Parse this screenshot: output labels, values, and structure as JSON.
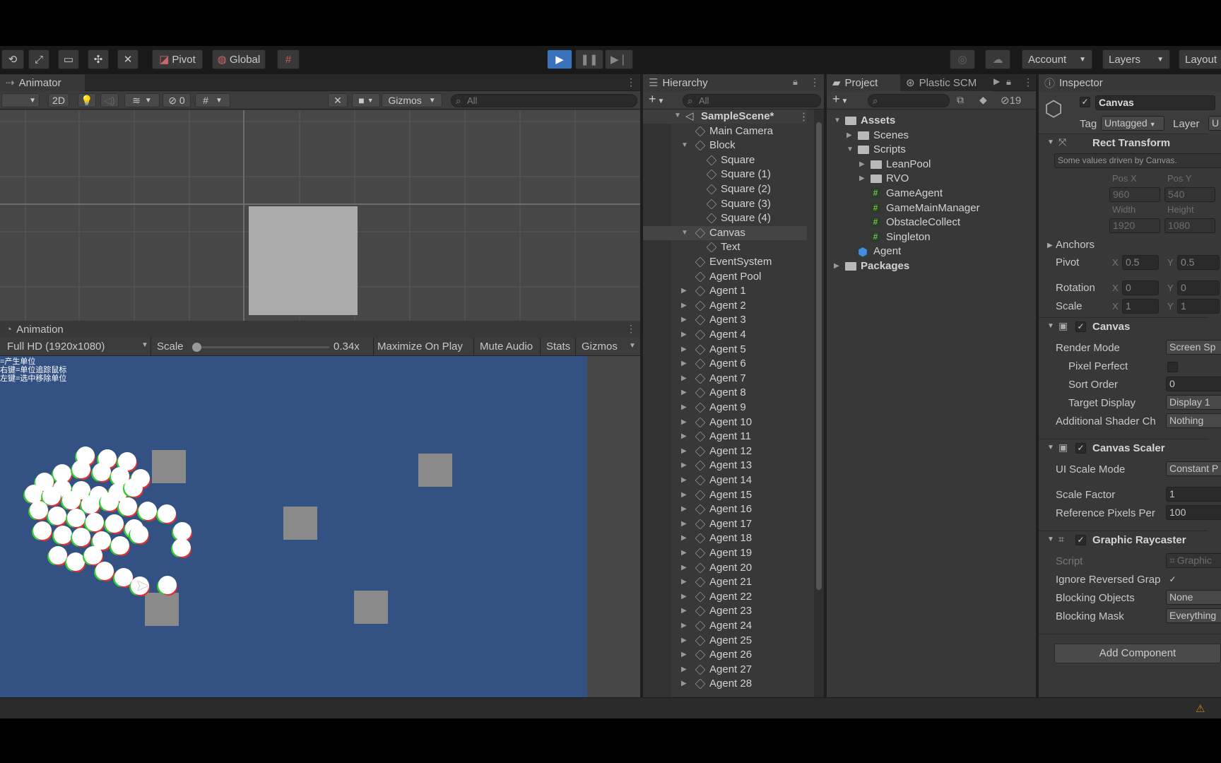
{
  "toolbar": {
    "pivot": "Pivot",
    "global": "Global",
    "account": "Account",
    "layers": "Layers",
    "layout": "Layout"
  },
  "animator": {
    "tab": "Animator",
    "mode_2d": "2D",
    "hidden_count": "0",
    "gizmos": "Gizmos",
    "search_placeholder": "All"
  },
  "game": {
    "tab": "Animation",
    "resolution": "Full HD (1920x1080)",
    "scale_label": "Scale",
    "scale_value": "0.34x",
    "maximize": "Maximize On Play",
    "mute": "Mute Audio",
    "stats": "Stats",
    "gizmos": "Gizmos",
    "overlay_lines": [
      "=产生单位",
      "右键=单位追踪鼠标",
      "左键=选中移除单位"
    ]
  },
  "hierarchy": {
    "tab": "Hierarchy",
    "search_placeholder": "All",
    "scene": "SampleScene*",
    "items": [
      {
        "label": "Main Camera"
      },
      {
        "label": "Block"
      },
      {
        "label": "Square"
      },
      {
        "label": "Square (1)"
      },
      {
        "label": "Square (2)"
      },
      {
        "label": "Square (3)"
      },
      {
        "label": "Square (4)"
      },
      {
        "label": "Canvas"
      },
      {
        "label": "Text"
      },
      {
        "label": "EventSystem"
      },
      {
        "label": "Agent Pool"
      },
      {
        "label": "Agent 1"
      },
      {
        "label": "Agent 2"
      },
      {
        "label": "Agent 3"
      },
      {
        "label": "Agent 4"
      },
      {
        "label": "Agent 5"
      },
      {
        "label": "Agent 6"
      },
      {
        "label": "Agent 7"
      },
      {
        "label": "Agent 8"
      },
      {
        "label": "Agent 9"
      },
      {
        "label": "Agent 10"
      },
      {
        "label": "Agent 11"
      },
      {
        "label": "Agent 12"
      },
      {
        "label": "Agent 13"
      },
      {
        "label": "Agent 14"
      },
      {
        "label": "Agent 15"
      },
      {
        "label": "Agent 16"
      },
      {
        "label": "Agent 17"
      },
      {
        "label": "Agent 18"
      },
      {
        "label": "Agent 19"
      },
      {
        "label": "Agent 20"
      },
      {
        "label": "Agent 21"
      },
      {
        "label": "Agent 22"
      },
      {
        "label": "Agent 23"
      },
      {
        "label": "Agent 24"
      },
      {
        "label": "Agent 25"
      },
      {
        "label": "Agent 26"
      },
      {
        "label": "Agent 27"
      },
      {
        "label": "Agent 28"
      }
    ]
  },
  "project": {
    "tab": "Project",
    "tab2": "Plastic SCM",
    "hidden_count": "19",
    "items": [
      {
        "label": "Assets",
        "kind": "folder"
      },
      {
        "label": "Scenes",
        "kind": "folder"
      },
      {
        "label": "Scripts",
        "kind": "folder"
      },
      {
        "label": "LeanPool",
        "kind": "folder"
      },
      {
        "label": "RVO",
        "kind": "folder"
      },
      {
        "label": "GameAgent",
        "kind": "script"
      },
      {
        "label": "GameMainManager",
        "kind": "script"
      },
      {
        "label": "ObstacleCollect",
        "kind": "script"
      },
      {
        "label": "Singleton",
        "kind": "script"
      },
      {
        "label": "Agent",
        "kind": "prefab"
      },
      {
        "label": "Packages",
        "kind": "folder"
      }
    ]
  },
  "inspector": {
    "tab": "Inspector",
    "object_name": "Canvas",
    "tag_label": "Tag",
    "tag_value": "Untagged",
    "layer_label": "Layer",
    "layer_value": "U",
    "rect_transform": "Rect Transform",
    "driven_note": "Some values driven by Canvas.",
    "pos_x_label": "Pos X",
    "pos_y_label": "Pos Y",
    "pos_x": "960",
    "pos_y": "540",
    "width_label": "Width",
    "height_label": "Height",
    "width": "1920",
    "height": "1080",
    "anchors": "Anchors",
    "pivot": "Pivot",
    "pivot_x": "0.5",
    "pivot_y": "0.5",
    "rotation": "Rotation",
    "rot_x": "0",
    "rot_y": "0",
    "scale": "Scale",
    "scale_x": "1",
    "scale_y": "1",
    "x": "X",
    "y": "Y",
    "canvas": "Canvas",
    "render_mode_label": "Render Mode",
    "render_mode": "Screen Sp",
    "pixel_perfect": "Pixel Perfect",
    "sort_order_label": "Sort Order",
    "sort_order": "0",
    "target_display_label": "Target Display",
    "target_display": "Display 1",
    "shader_label": "Additional Shader Ch",
    "shader_value": "Nothing",
    "canvas_scaler": "Canvas Scaler",
    "ui_scale_label": "UI Scale Mode",
    "ui_scale_value": "Constant P",
    "scale_factor_label": "Scale Factor",
    "scale_factor": "1",
    "ref_pixels_label": "Reference Pixels Per",
    "ref_pixels": "100",
    "graphic_raycaster": "Graphic Raycaster",
    "script_label": "Script",
    "script_value": "Graphic",
    "ignore_label": "Ignore Reversed Grap",
    "blocking_objects_label": "Blocking Objects",
    "blocking_objects": "None",
    "blocking_mask_label": "Blocking Mask",
    "blocking_mask": "Everything",
    "add_component": "Add Component"
  },
  "colors": {
    "game_bg": "#335283",
    "panel": "#383838",
    "toolbar": "#191919",
    "play_blue": "#3a73bd"
  }
}
